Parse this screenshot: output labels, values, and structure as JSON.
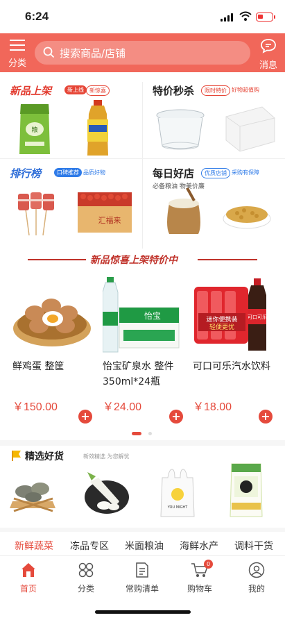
{
  "status": {
    "time": "6:24"
  },
  "header": {
    "category_label": "分类",
    "search_placeholder": "搜索商品/店铺",
    "message_label": "消息",
    "bg_color": "#f1675a"
  },
  "promo": {
    "new": {
      "title": "新品上架",
      "tags": [
        "新上线",
        "新惊喜"
      ]
    },
    "flash": {
      "title": "特价秒杀",
      "tags": [
        "限时特价",
        "好物超值购"
      ]
    },
    "rank": {
      "title": "排行榜",
      "tags": [
        "口碑推荐",
        "品质好物"
      ]
    },
    "daily": {
      "title": "每日好店",
      "sub": "必备粮油 物美价廉",
      "tags": [
        "优质店铺",
        "采购有保障"
      ]
    }
  },
  "banner": {
    "title": "新品惊喜上架特价中"
  },
  "products": [
    {
      "name": "鲜鸡蛋 整筐",
      "price": "￥150.00"
    },
    {
      "name": "怡宝矿泉水 整件350ml*24瓶",
      "price": "￥24.00"
    },
    {
      "name": "可口可乐汽水饮料",
      "price": "￥18.00"
    }
  ],
  "product_image_text": {
    "water_brand": "怡宝",
    "cola_brand": "可口可乐",
    "cola_pack": "迷你便携装",
    "cola_pack2": "轻便更优",
    "sausage_brand": "汇福来",
    "rice_bag": "YOU MIGHT"
  },
  "selected": {
    "title": "精选好货",
    "sub": "新效精选 为您解忧"
  },
  "categories": [
    "新鲜蔬菜",
    "冻品专区",
    "米面粮油",
    "海鲜水产",
    "调料干货"
  ],
  "nav": {
    "home": "首页",
    "category": "分类",
    "list": "常购清单",
    "cart": "购物车",
    "cart_count": "0",
    "me": "我的"
  },
  "colors": {
    "accent": "#e54a3c",
    "brand": "#f1675a",
    "blue": "#2f6ed8"
  }
}
